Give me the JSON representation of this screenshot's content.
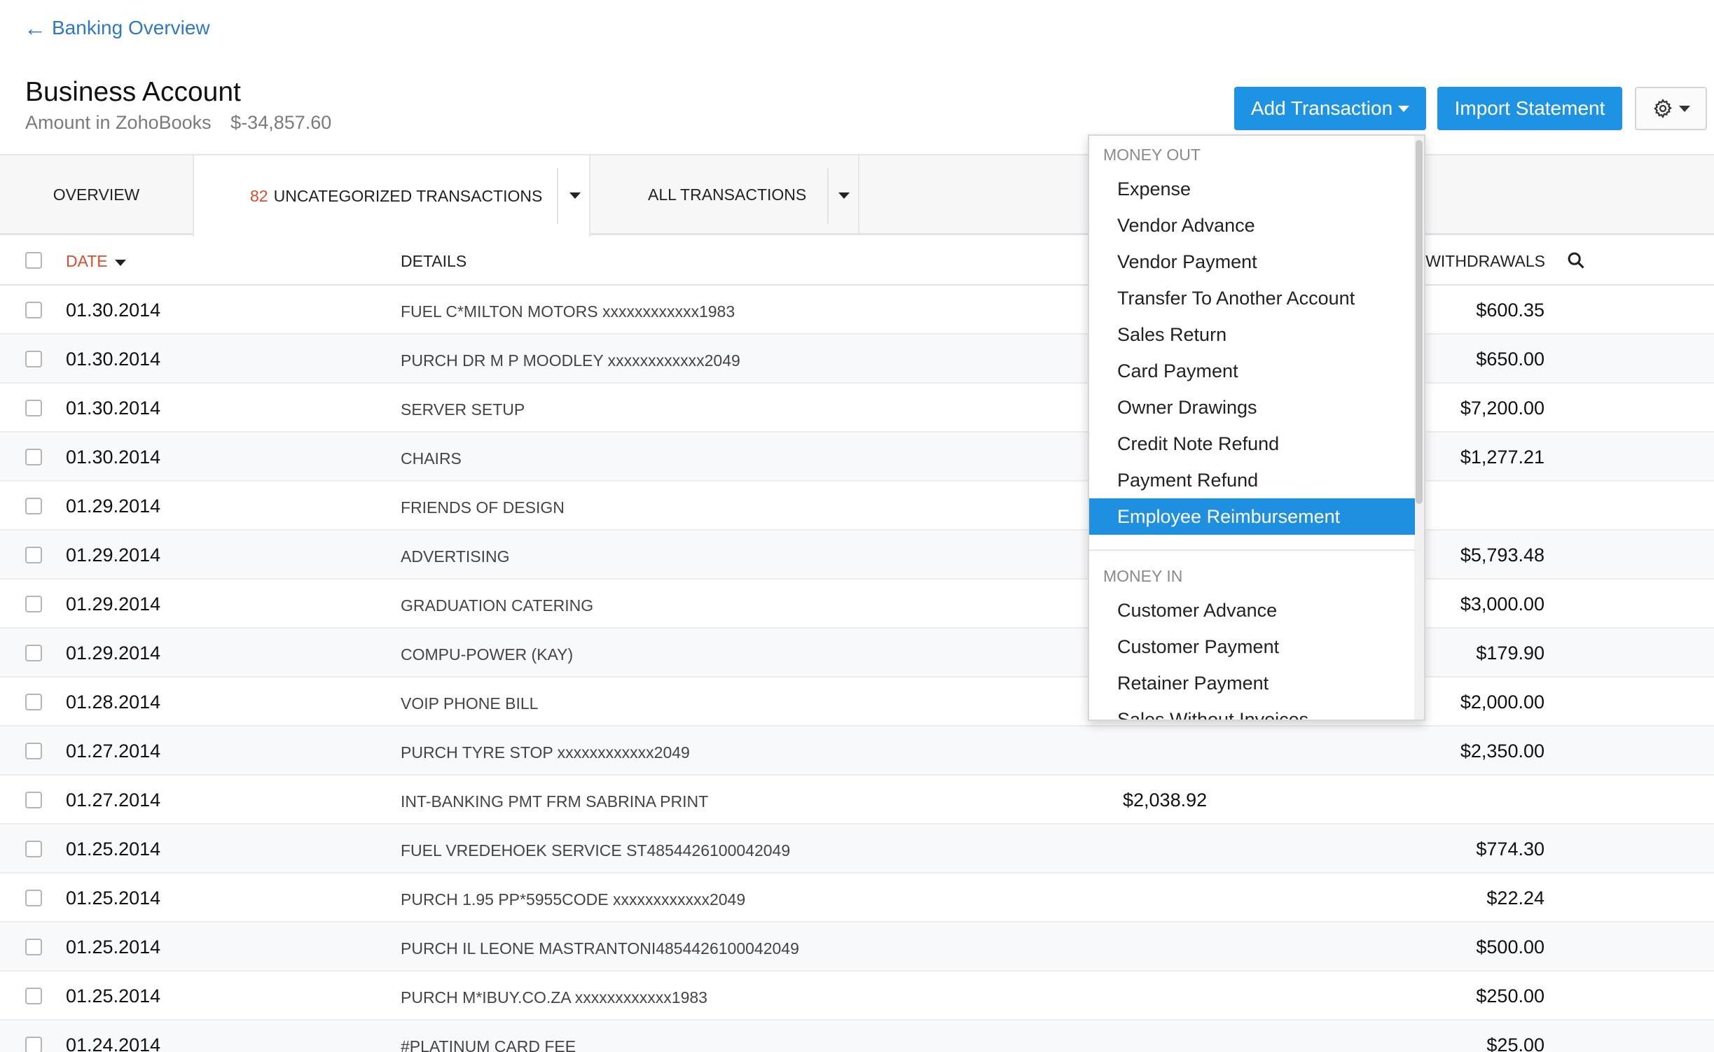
{
  "nav": {
    "back_label": "Banking Overview"
  },
  "account": {
    "title": "Business Account",
    "amount_label": "Amount in ZohoBooks",
    "amount_value": "$-34,857.60"
  },
  "actions": {
    "add_transaction": "Add Transaction",
    "import_statement": "Import Statement"
  },
  "tabs": {
    "overview": "OVERVIEW",
    "uncategorized_count": "82",
    "uncategorized_label": "UNCATEGORIZED TRANSACTIONS",
    "all": "ALL TRANSACTIONS"
  },
  "table": {
    "headers": {
      "date": "DATE",
      "details": "DETAILS",
      "withdrawals": "WITHDRAWALS"
    },
    "rows": [
      {
        "date": "01.30.2014",
        "details": "FUEL C*MILTON MOTORS xxxxxxxxxxxx1983",
        "deposit": "",
        "withdrawal": "$600.35"
      },
      {
        "date": "01.30.2014",
        "details": "PURCH DR M P MOODLEY xxxxxxxxxxxx2049",
        "deposit": "",
        "withdrawal": "$650.00"
      },
      {
        "date": "01.30.2014",
        "details": "SERVER SETUP",
        "deposit": "",
        "withdrawal": "$7,200.00"
      },
      {
        "date": "01.30.2014",
        "details": "CHAIRS",
        "deposit": "",
        "withdrawal": "$1,277.21"
      },
      {
        "date": "01.29.2014",
        "details": "FRIENDS OF DESIGN",
        "deposit": "",
        "withdrawal": ""
      },
      {
        "date": "01.29.2014",
        "details": "ADVERTISING",
        "deposit": "",
        "withdrawal": "$5,793.48"
      },
      {
        "date": "01.29.2014",
        "details": "GRADUATION CATERING",
        "deposit": "",
        "withdrawal": "$3,000.00"
      },
      {
        "date": "01.29.2014",
        "details": "COMPU-POWER (KAY)",
        "deposit": "",
        "withdrawal": "$179.90"
      },
      {
        "date": "01.28.2014",
        "details": "VOIP PHONE BILL",
        "deposit": "",
        "withdrawal": "$2,000.00"
      },
      {
        "date": "01.27.2014",
        "details": "PURCH TYRE STOP xxxxxxxxxxxx2049",
        "deposit": "",
        "withdrawal": "$2,350.00"
      },
      {
        "date": "01.27.2014",
        "details": "INT-BANKING PMT FRM SABRINA PRINT",
        "deposit": "$2,038.92",
        "withdrawal": ""
      },
      {
        "date": "01.25.2014",
        "details": "FUEL VREDEHOEK SERVICE ST4854426100042049",
        "deposit": "",
        "withdrawal": "$774.30"
      },
      {
        "date": "01.25.2014",
        "details": "PURCH 1.95 PP*5955CODE xxxxxxxxxxxx2049",
        "deposit": "",
        "withdrawal": "$22.24"
      },
      {
        "date": "01.25.2014",
        "details": "PURCH IL LEONE MASTRANTONI4854426100042049",
        "deposit": "",
        "withdrawal": "$500.00"
      },
      {
        "date": "01.25.2014",
        "details": "PURCH M*IBUY.CO.ZA xxxxxxxxxxxx1983",
        "deposit": "",
        "withdrawal": "$250.00"
      },
      {
        "date": "01.24.2014",
        "details": "#PLATINUM CARD FEE",
        "deposit": "",
        "withdrawal": "$25.00"
      }
    ]
  },
  "dropdown": {
    "money_out_label": "MONEY OUT",
    "money_out": [
      "Expense",
      "Vendor Advance",
      "Vendor Payment",
      "Transfer To Another Account",
      "Sales Return",
      "Card Payment",
      "Owner Drawings",
      "Credit Note Refund",
      "Payment Refund",
      "Employee Reimbursement"
    ],
    "active_item": "Employee Reimbursement",
    "money_in_label": "MONEY IN",
    "money_in": [
      "Customer Advance",
      "Customer Payment",
      "Retainer Payment",
      "Sales Without Invoices"
    ]
  },
  "colors": {
    "accent": "#1f93e3",
    "highlight": "#e04a2f",
    "link": "#2f78c4"
  }
}
